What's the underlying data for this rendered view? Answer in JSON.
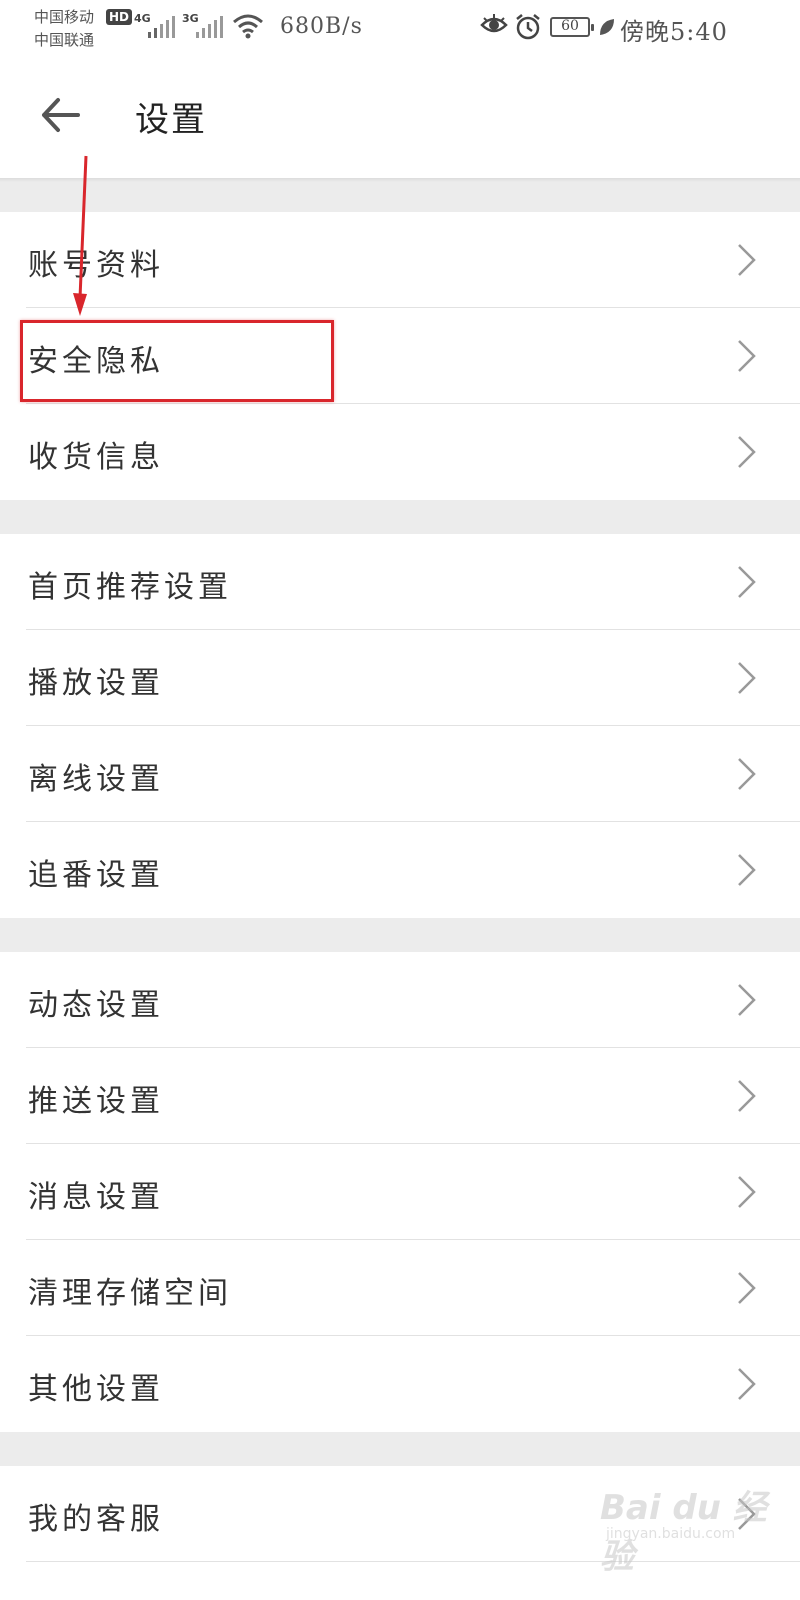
{
  "status_bar": {
    "carrier_1": "中国移动",
    "carrier_2": "中国联通",
    "hd_badge": "HD",
    "net_1": "4G",
    "net_2": "3G",
    "speed": "680B/s",
    "battery_level": "60",
    "time": "傍晚5:40"
  },
  "header": {
    "back_icon": "arrow-left-icon",
    "title": "设置"
  },
  "sections": [
    {
      "items": [
        {
          "label": "账号资料"
        },
        {
          "label": "安全隐私"
        },
        {
          "label": "收货信息"
        }
      ]
    },
    {
      "items": [
        {
          "label": "首页推荐设置"
        },
        {
          "label": "播放设置"
        },
        {
          "label": "离线设置"
        },
        {
          "label": "追番设置"
        }
      ]
    },
    {
      "items": [
        {
          "label": "动态设置"
        },
        {
          "label": "推送设置"
        },
        {
          "label": "消息设置"
        },
        {
          "label": "清理存储空间"
        },
        {
          "label": "其他设置"
        }
      ]
    },
    {
      "items": [
        {
          "label": "我的客服"
        }
      ]
    }
  ],
  "annotation": {
    "highlighted_item": "安全隐私",
    "color": "#d9262c"
  },
  "watermark": {
    "main": "Bai du 经验",
    "sub": "jingyan.baidu.com"
  },
  "colors": {
    "background": "#ffffff",
    "section_gap": "#ececec",
    "text": "#333333",
    "chevron": "#999999"
  }
}
